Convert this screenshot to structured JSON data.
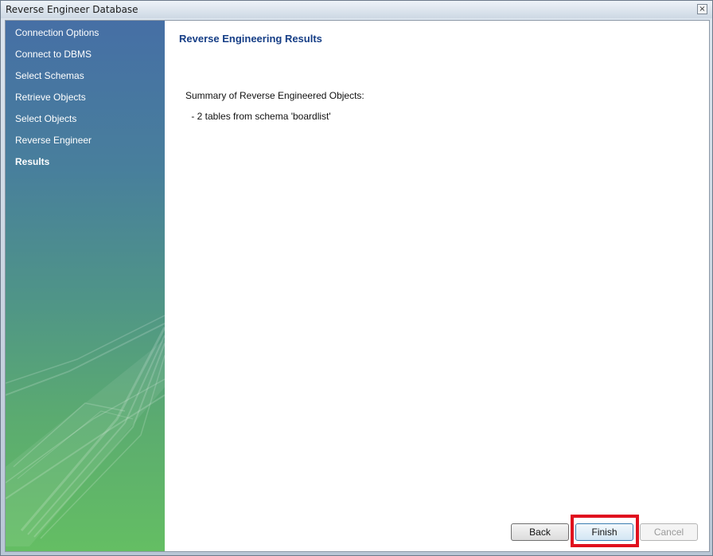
{
  "window": {
    "title": "Reverse Engineer Database",
    "close_glyph": "×"
  },
  "sidebar": {
    "items": [
      {
        "label": "Connection Options",
        "active": false
      },
      {
        "label": "Connect to DBMS",
        "active": false
      },
      {
        "label": "Select Schemas",
        "active": false
      },
      {
        "label": "Retrieve Objects",
        "active": false
      },
      {
        "label": "Select Objects",
        "active": false
      },
      {
        "label": "Reverse Engineer",
        "active": false
      },
      {
        "label": "Results",
        "active": true
      }
    ]
  },
  "main": {
    "title": "Reverse Engineering Results",
    "summary_label": "Summary of Reverse Engineered Objects:",
    "summary_lines": [
      " - 2 tables from schema 'boardlist'"
    ]
  },
  "buttons": {
    "back": "Back",
    "finish": "Finish",
    "cancel": "Cancel"
  },
  "colors": {
    "title_blue": "#163e86",
    "highlight_red": "#e0101e",
    "sidebar_top": "#466fa5",
    "sidebar_bottom": "#64be63"
  }
}
